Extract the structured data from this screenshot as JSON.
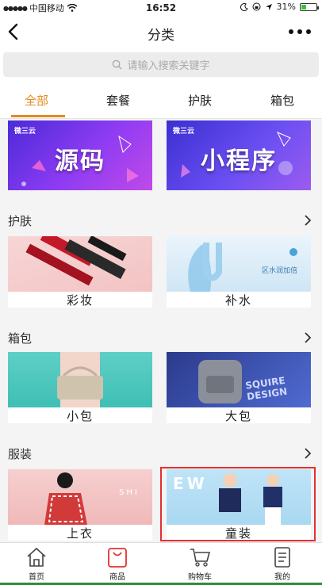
{
  "status_bar": {
    "carrier": "中国移动",
    "time": "16:52",
    "battery": "31%"
  },
  "navbar": {
    "title": "分类"
  },
  "search": {
    "placeholder": "请输入搜索关键字"
  },
  "tabs": [
    {
      "label": "全部",
      "active": true
    },
    {
      "label": "套餐",
      "active": false
    },
    {
      "label": "护肤",
      "active": false
    },
    {
      "label": "箱包",
      "active": false
    }
  ],
  "banners": [
    {
      "logo": "微三云",
      "text": "源码",
      "color": "#8a3cf0"
    },
    {
      "logo": "微三云",
      "text": "小程序",
      "color": "#6a4ef2"
    }
  ],
  "sections": [
    {
      "title": "护肤",
      "items": [
        {
          "label": "彩妆"
        },
        {
          "label": "补水"
        }
      ]
    },
    {
      "title": "箱包",
      "items": [
        {
          "label": "小包"
        },
        {
          "label": "大包"
        }
      ]
    },
    {
      "title": "服装",
      "items": [
        {
          "label": "上衣"
        },
        {
          "label": "童装"
        }
      ]
    }
  ],
  "image_text": {
    "water_brand": "区水润加倍",
    "bag_text": "SQUIRE DESIGN",
    "coat_text": "SHI",
    "kids_text": "EW"
  },
  "bottom_nav": [
    {
      "label": "首页",
      "icon": "home-icon"
    },
    {
      "label": "商品",
      "icon": "shopping-bag-icon",
      "active": true
    },
    {
      "label": "购物车",
      "icon": "cart-icon"
    },
    {
      "label": "我的",
      "icon": "profile-document-icon"
    }
  ],
  "colors": {
    "accent": "#e58a1f",
    "highlight_border": "#e53030",
    "bag_icon_active": "#e53030"
  }
}
